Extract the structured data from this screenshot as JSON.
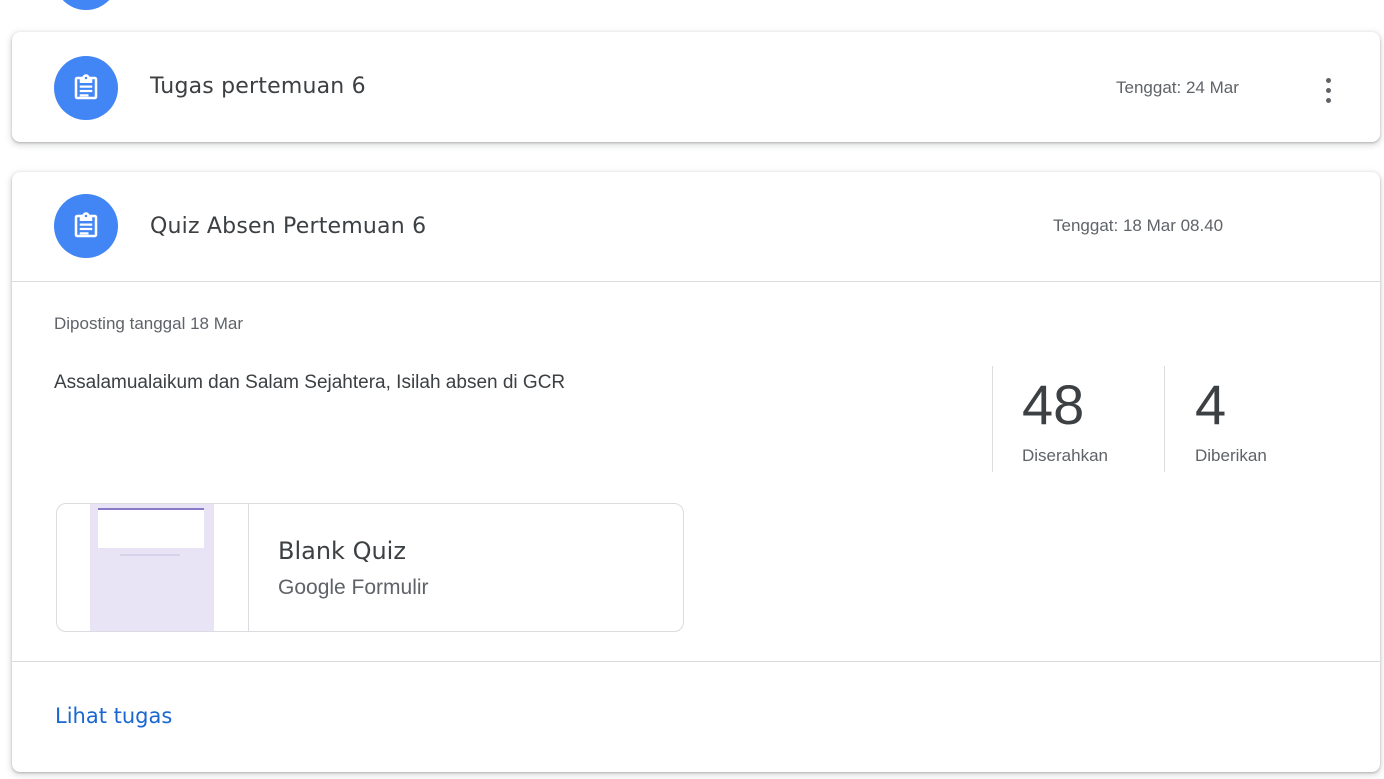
{
  "assignments": [
    {
      "title": "Tugas pertemuan 6",
      "due": "Tenggat: 24 Mar",
      "icon": "assignment-icon"
    },
    {
      "title": "Quiz Absen Pertemuan 6",
      "due": "Tenggat: 18 Mar 08.40",
      "icon": "assignment-icon",
      "posted": "Diposting tanggal 18 Mar",
      "description": "Assalamualaikum dan Salam Sejahtera, Isilah absen di GCR",
      "stats": [
        {
          "value": "48",
          "label": "Diserahkan"
        },
        {
          "value": "4",
          "label": "Diberikan"
        }
      ],
      "attachment": {
        "title": "Blank Quiz",
        "subtitle": "Google Formulir"
      },
      "link": "Lihat tugas"
    }
  ],
  "colors": {
    "accent": "#4285f4",
    "link": "#1967d2",
    "text": "#3c4043",
    "muted": "#5f6368"
  }
}
